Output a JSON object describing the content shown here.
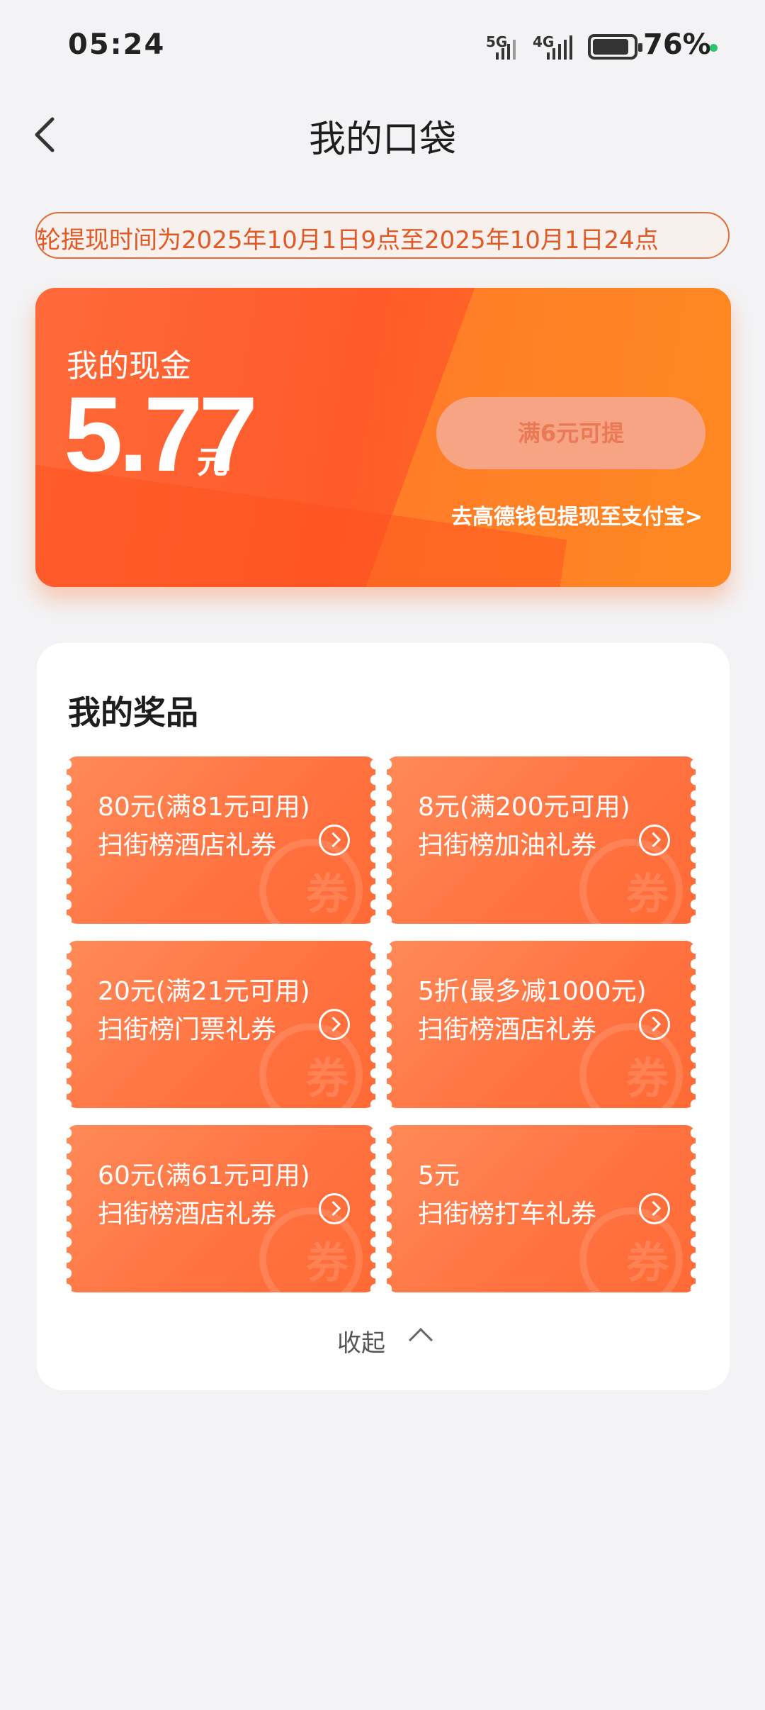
{
  "status_bar": {
    "time": "05:24",
    "net1": "5G",
    "net2": "4G",
    "battery": "76%"
  },
  "header": {
    "title": "我的口袋"
  },
  "notice": {
    "text": "轮提现时间为2025年10月1日9点至2025年10月1日24点"
  },
  "cash": {
    "label": "我的现金",
    "amount": "5.77",
    "unit": "元",
    "button": "满6元可提",
    "link": "去高德钱包提现至支付宝>"
  },
  "prizes": {
    "title": "我的奖品",
    "watermark": "券",
    "items": [
      {
        "value": "80元(满81元可用)",
        "name": "扫街榜酒店礼券"
      },
      {
        "value": "8元(满200元可用)",
        "name": "扫街榜加油礼券"
      },
      {
        "value": "20元(满21元可用)",
        "name": "扫街榜门票礼券"
      },
      {
        "value": "5折(最多减1000元)",
        "name": "扫街榜酒店礼券"
      },
      {
        "value": "60元(满61元可用)",
        "name": "扫街榜酒店礼券"
      },
      {
        "value": "5元",
        "name": "扫街榜打车礼券"
      }
    ],
    "collapse": "收起"
  }
}
